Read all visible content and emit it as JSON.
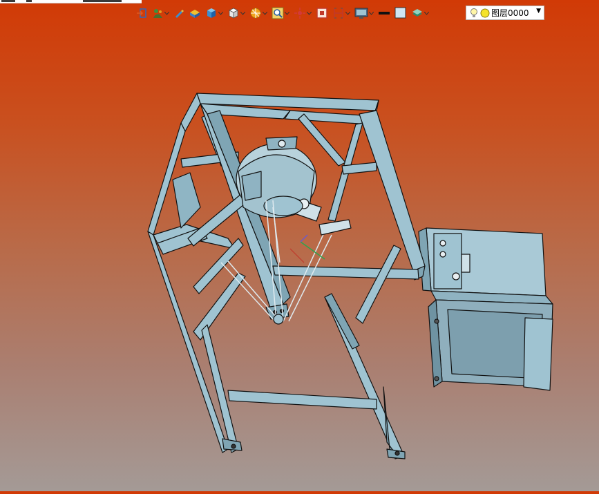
{
  "toolbar": {
    "items": [
      {
        "name": "exit-icon",
        "has_dropdown": false
      },
      {
        "name": "snap-icon",
        "has_dropdown": true
      },
      {
        "name": "pencil-icon",
        "has_dropdown": false
      },
      {
        "name": "material-icon",
        "has_dropdown": false
      },
      {
        "name": "shading-icon",
        "has_dropdown": true
      },
      {
        "name": "view-cube-icon",
        "has_dropdown": true
      },
      {
        "name": "render-style-icon",
        "has_dropdown": true
      },
      {
        "name": "zoom-icon",
        "has_dropdown": true
      },
      {
        "name": "pan-icon",
        "has_dropdown": true
      },
      {
        "name": "fit-view-icon",
        "has_dropdown": false
      },
      {
        "name": "section-icon",
        "has_dropdown": true
      },
      {
        "name": "display-icon",
        "has_dropdown": true
      },
      {
        "name": "line-color-icon",
        "has_dropdown": false
      },
      {
        "name": "fill-color-icon",
        "has_dropdown": false
      },
      {
        "name": "layer-stack-icon",
        "has_dropdown": true
      }
    ]
  },
  "layer": {
    "label": "图层0000",
    "bulb_icon": "light-bulb-icon",
    "status_icon": "layer-visible-icon",
    "dropdown_icon": "chevron-down-icon"
  },
  "colors": {
    "bg_top": "#d13a06",
    "bg_bottom": "#a49a96",
    "frame": "#9fc3d1",
    "frame_dark": "#6f97a6",
    "edge": "#111111"
  }
}
